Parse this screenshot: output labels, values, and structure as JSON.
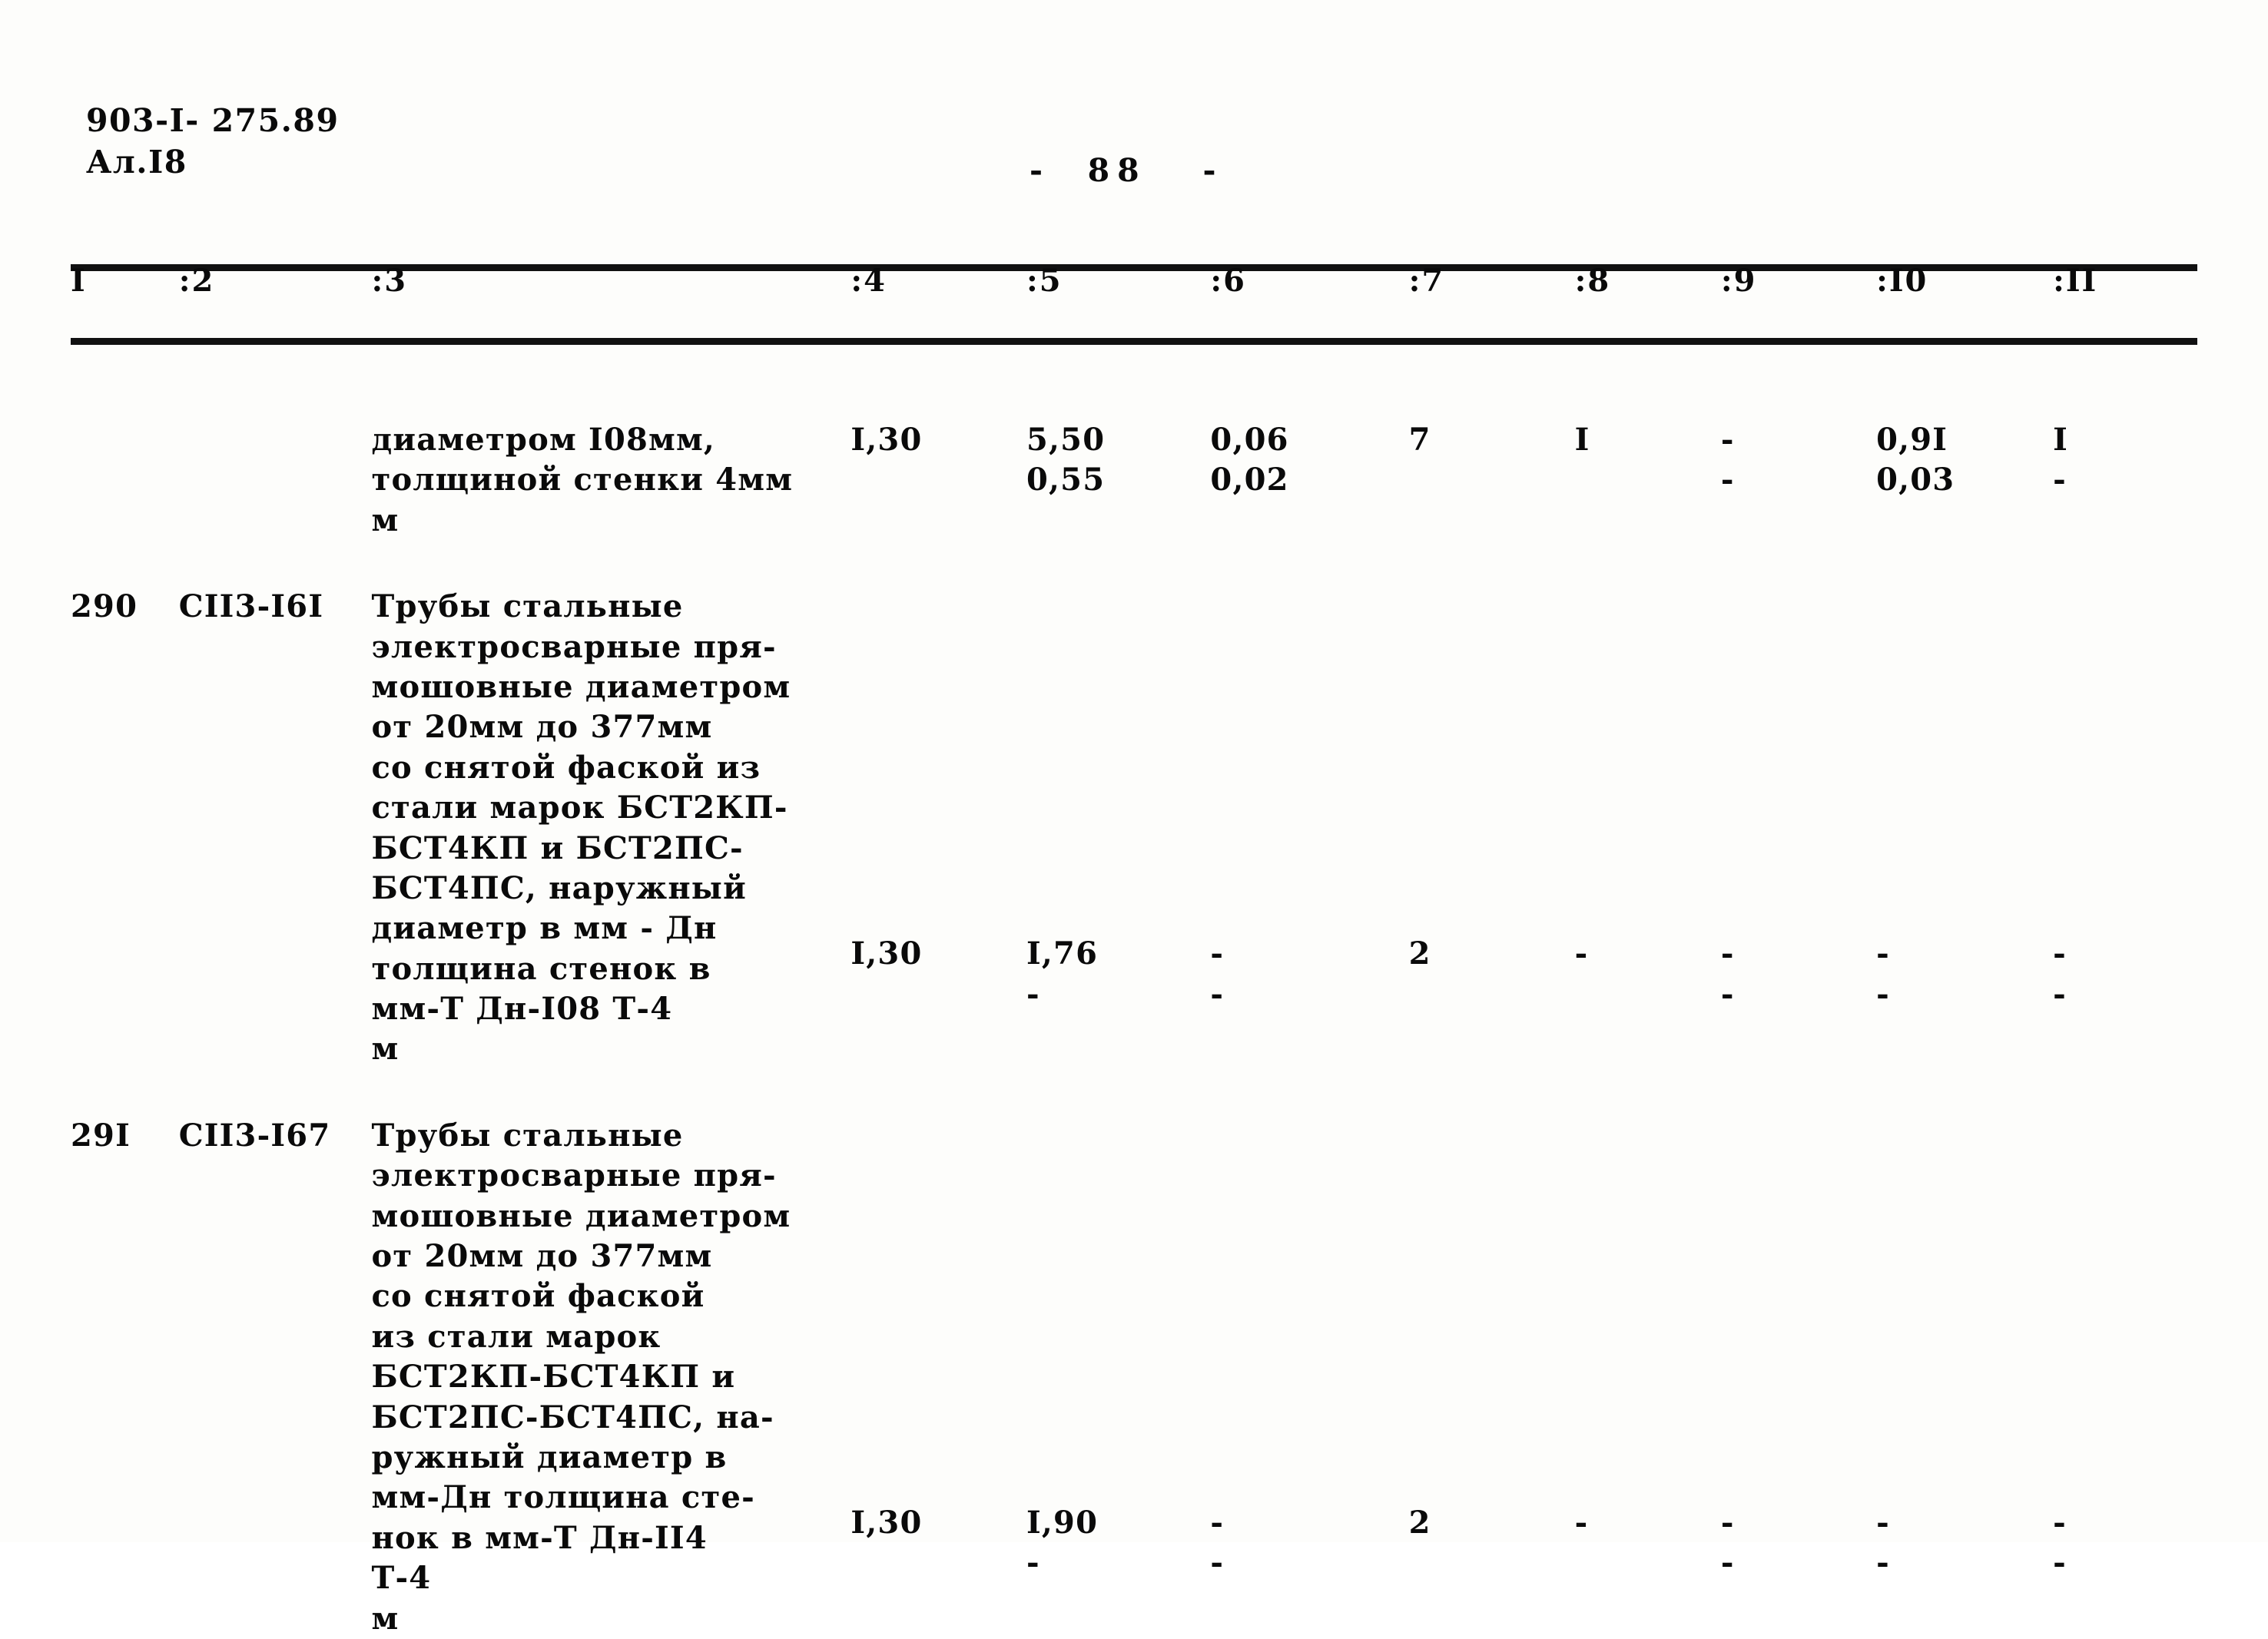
{
  "header": {
    "doc_code_line1": "903-I- 275.89",
    "doc_code_line2": "Ал.I8",
    "page_marker": "-  88   -"
  },
  "table": {
    "columns": [
      "I",
      ":2",
      ":3",
      ":4",
      ":5",
      ":6",
      ":7",
      ":8",
      ":9",
      ":I0",
      ":II"
    ],
    "rows": [
      {
        "num": "",
        "code": "",
        "description": "диаметром I08мм,\nтолщиной стенки 4мм\nм",
        "c4": "I,30",
        "c5_a": "5,50",
        "c5_b": "0,55",
        "c6_a": "0,06",
        "c6_b": "0,02",
        "c7": "7",
        "c8": "I",
        "c9_a": "-",
        "c9_b": "-",
        "c10_a": "0,9I",
        "c10_b": "0,03",
        "c11_a": "I",
        "c11_b": "-"
      },
      {
        "num": "290",
        "code": "СII3-I6I",
        "description": "Трубы стальные\nэлектросварные пря-\nмошовные диаметром\nот 20мм до 377мм\nсо снятой фаской из\nстали марок БСТ2КП-\nБСТ4КП и БСТ2ПС-\nБСТ4ПС, наружный\nдиаметр в мм - Дн\nтолщина стенок в\nмм-Т Дн-I08 Т-4\nм",
        "c4": "I,30",
        "c5_a": "I,76",
        "c5_b": "-",
        "c6_a": "-",
        "c6_b": "-",
        "c7": "2",
        "c8": "-",
        "c9_a": "-",
        "c9_b": "-",
        "c10_a": "-",
        "c10_b": "-",
        "c11_a": "-",
        "c11_b": "-"
      },
      {
        "num": "29I",
        "code": "СII3-I67",
        "description": "Трубы стальные\nэлектросварные пря-\nмошовные диаметром\nот 20мм до 377мм\nсо снятой фаской\nиз стали марок\nБСТ2КП-БСТ4КП и\nБСТ2ПС-БСТ4ПС, на-\nружный диаметр в\nмм-Дн толщина сте-\nнок в мм-Т Дн-II4\nТ-4\nм",
        "c4": "I,30",
        "c5_a": "I,90",
        "c5_b": "-",
        "c6_a": "-",
        "c6_b": "-",
        "c7": "2",
        "c8": "-",
        "c9_a": "-",
        "c9_b": "-",
        "c10_a": "-",
        "c10_b": "-",
        "c11_a": "-",
        "c11_b": "-"
      }
    ]
  }
}
